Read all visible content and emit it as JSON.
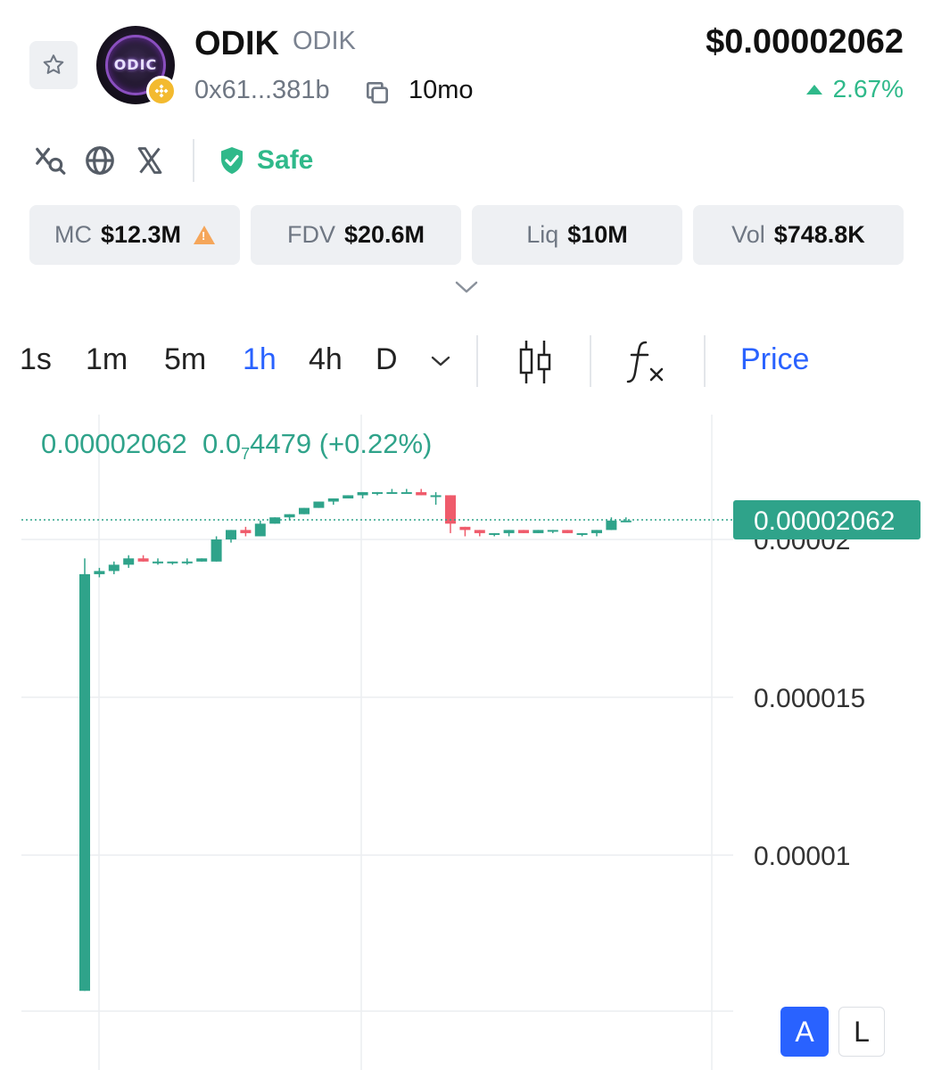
{
  "token": {
    "name": "ODIK",
    "symbol": "ODIK",
    "logo_text": "ODIC",
    "address_short": "0x61...381b",
    "age": "10mo",
    "price": "$0.00002062",
    "change": "2.67%"
  },
  "socials": {
    "safety_label": "Safe",
    "icons": [
      "search-x-icon",
      "globe-icon",
      "x-icon"
    ]
  },
  "stats": {
    "mc_label": "MC",
    "mc_value": "$12.3M",
    "fdv_label": "FDV",
    "fdv_value": "$20.6M",
    "liq_label": "Liq",
    "liq_value": "$10M",
    "vol_label": "Vol",
    "vol_value": "$748.8K"
  },
  "toolbar": {
    "timeframes": [
      "1s",
      "1m",
      "5m",
      "1h",
      "4h",
      "D"
    ],
    "active_timeframe": "1h",
    "price_tab": "Price"
  },
  "legend": {
    "last": "0.00002062",
    "delta_prefix": "0.0",
    "delta_sub": "7",
    "delta_digits": "4479",
    "delta_pct": "(+0.22%)"
  },
  "scale_buttons": {
    "auto": "A",
    "log": "L"
  },
  "colors": {
    "up": "#2fa38a",
    "down": "#ef5b6b",
    "accent": "#2962ff"
  },
  "chart_data": {
    "type": "candlestick",
    "price_axis": {
      "ticks": [
        "0.00002",
        "0.000015",
        "0.00001"
      ],
      "ylim": [
        5.3e-06,
        2.35e-05
      ]
    },
    "last_price_label": "0.00002062",
    "candles": [
      {
        "o": 5.7e-06,
        "h": 1.94e-05,
        "l": 5.7e-06,
        "c": 1.89e-05
      },
      {
        "o": 1.89e-05,
        "h": 1.91e-05,
        "l": 1.88e-05,
        "c": 1.9e-05
      },
      {
        "o": 1.9e-05,
        "h": 1.93e-05,
        "l": 1.89e-05,
        "c": 1.92e-05
      },
      {
        "o": 1.92e-05,
        "h": 1.95e-05,
        "l": 1.91e-05,
        "c": 1.94e-05
      },
      {
        "o": 1.94e-05,
        "h": 1.95e-05,
        "l": 1.93e-05,
        "c": 1.93e-05
      },
      {
        "o": 1.93e-05,
        "h": 1.94e-05,
        "l": 1.92e-05,
        "c": 1.93e-05
      },
      {
        "o": 1.93e-05,
        "h": 1.93e-05,
        "l": 1.92e-05,
        "c": 1.93e-05
      },
      {
        "o": 1.93e-05,
        "h": 1.94e-05,
        "l": 1.92e-05,
        "c": 1.93e-05
      },
      {
        "o": 1.93e-05,
        "h": 1.94e-05,
        "l": 1.93e-05,
        "c": 1.94e-05
      },
      {
        "o": 1.93e-05,
        "h": 2.01e-05,
        "l": 1.93e-05,
        "c": 2e-05
      },
      {
        "o": 2e-05,
        "h": 2.03e-05,
        "l": 1.99e-05,
        "c": 2.03e-05
      },
      {
        "o": 2.03e-05,
        "h": 2.04e-05,
        "l": 2.01e-05,
        "c": 2.02e-05
      },
      {
        "o": 2.01e-05,
        "h": 2.06e-05,
        "l": 2.01e-05,
        "c": 2.05e-05
      },
      {
        "o": 2.05e-05,
        "h": 2.07e-05,
        "l": 2.05e-05,
        "c": 2.07e-05
      },
      {
        "o": 2.07e-05,
        "h": 2.08e-05,
        "l": 2.06e-05,
        "c": 2.08e-05
      },
      {
        "o": 2.08e-05,
        "h": 2.1e-05,
        "l": 2.08e-05,
        "c": 2.1e-05
      },
      {
        "o": 2.1e-05,
        "h": 2.12e-05,
        "l": 2.1e-05,
        "c": 2.12e-05
      },
      {
        "o": 2.12e-05,
        "h": 2.13e-05,
        "l": 2.11e-05,
        "c": 2.13e-05
      },
      {
        "o": 2.13e-05,
        "h": 2.14e-05,
        "l": 2.13e-05,
        "c": 2.14e-05
      },
      {
        "o": 2.14e-05,
        "h": 2.15e-05,
        "l": 2.13e-05,
        "c": 2.15e-05
      },
      {
        "o": 2.15e-05,
        "h": 2.15e-05,
        "l": 2.14e-05,
        "c": 2.15e-05
      },
      {
        "o": 2.15e-05,
        "h": 2.16e-05,
        "l": 2.15e-05,
        "c": 2.15e-05
      },
      {
        "o": 2.15e-05,
        "h": 2.16e-05,
        "l": 2.15e-05,
        "c": 2.15e-05
      },
      {
        "o": 2.15e-05,
        "h": 2.16e-05,
        "l": 2.14e-05,
        "c": 2.14e-05
      },
      {
        "o": 2.14e-05,
        "h": 2.15e-05,
        "l": 2.11e-05,
        "c": 2.14e-05
      },
      {
        "o": 2.14e-05,
        "h": 2.14e-05,
        "l": 2.02e-05,
        "c": 2.05e-05
      },
      {
        "o": 2.04e-05,
        "h": 2.04e-05,
        "l": 2.01e-05,
        "c": 2.03e-05
      },
      {
        "o": 2.03e-05,
        "h": 2.03e-05,
        "l": 2.01e-05,
        "c": 2.02e-05
      },
      {
        "o": 2.02e-05,
        "h": 2.02e-05,
        "l": 2.01e-05,
        "c": 2.02e-05
      },
      {
        "o": 2.02e-05,
        "h": 2.03e-05,
        "l": 2.01e-05,
        "c": 2.03e-05
      },
      {
        "o": 2.03e-05,
        "h": 2.03e-05,
        "l": 2.02e-05,
        "c": 2.02e-05
      },
      {
        "o": 2.02e-05,
        "h": 2.03e-05,
        "l": 2.02e-05,
        "c": 2.03e-05
      },
      {
        "o": 2.03e-05,
        "h": 2.03e-05,
        "l": 2.02e-05,
        "c": 2.03e-05
      },
      {
        "o": 2.03e-05,
        "h": 2.03e-05,
        "l": 2.02e-05,
        "c": 2.02e-05
      },
      {
        "o": 2.02e-05,
        "h": 2.02e-05,
        "l": 2.01e-05,
        "c": 2.02e-05
      },
      {
        "o": 2.02e-05,
        "h": 2.03e-05,
        "l": 2.01e-05,
        "c": 2.03e-05
      },
      {
        "o": 2.03e-05,
        "h": 2.07e-05,
        "l": 2.03e-05,
        "c": 2.06e-05
      },
      {
        "o": 2.06e-05,
        "h": 2.07e-05,
        "l": 2.06e-05,
        "c": 2.06e-05
      }
    ]
  }
}
